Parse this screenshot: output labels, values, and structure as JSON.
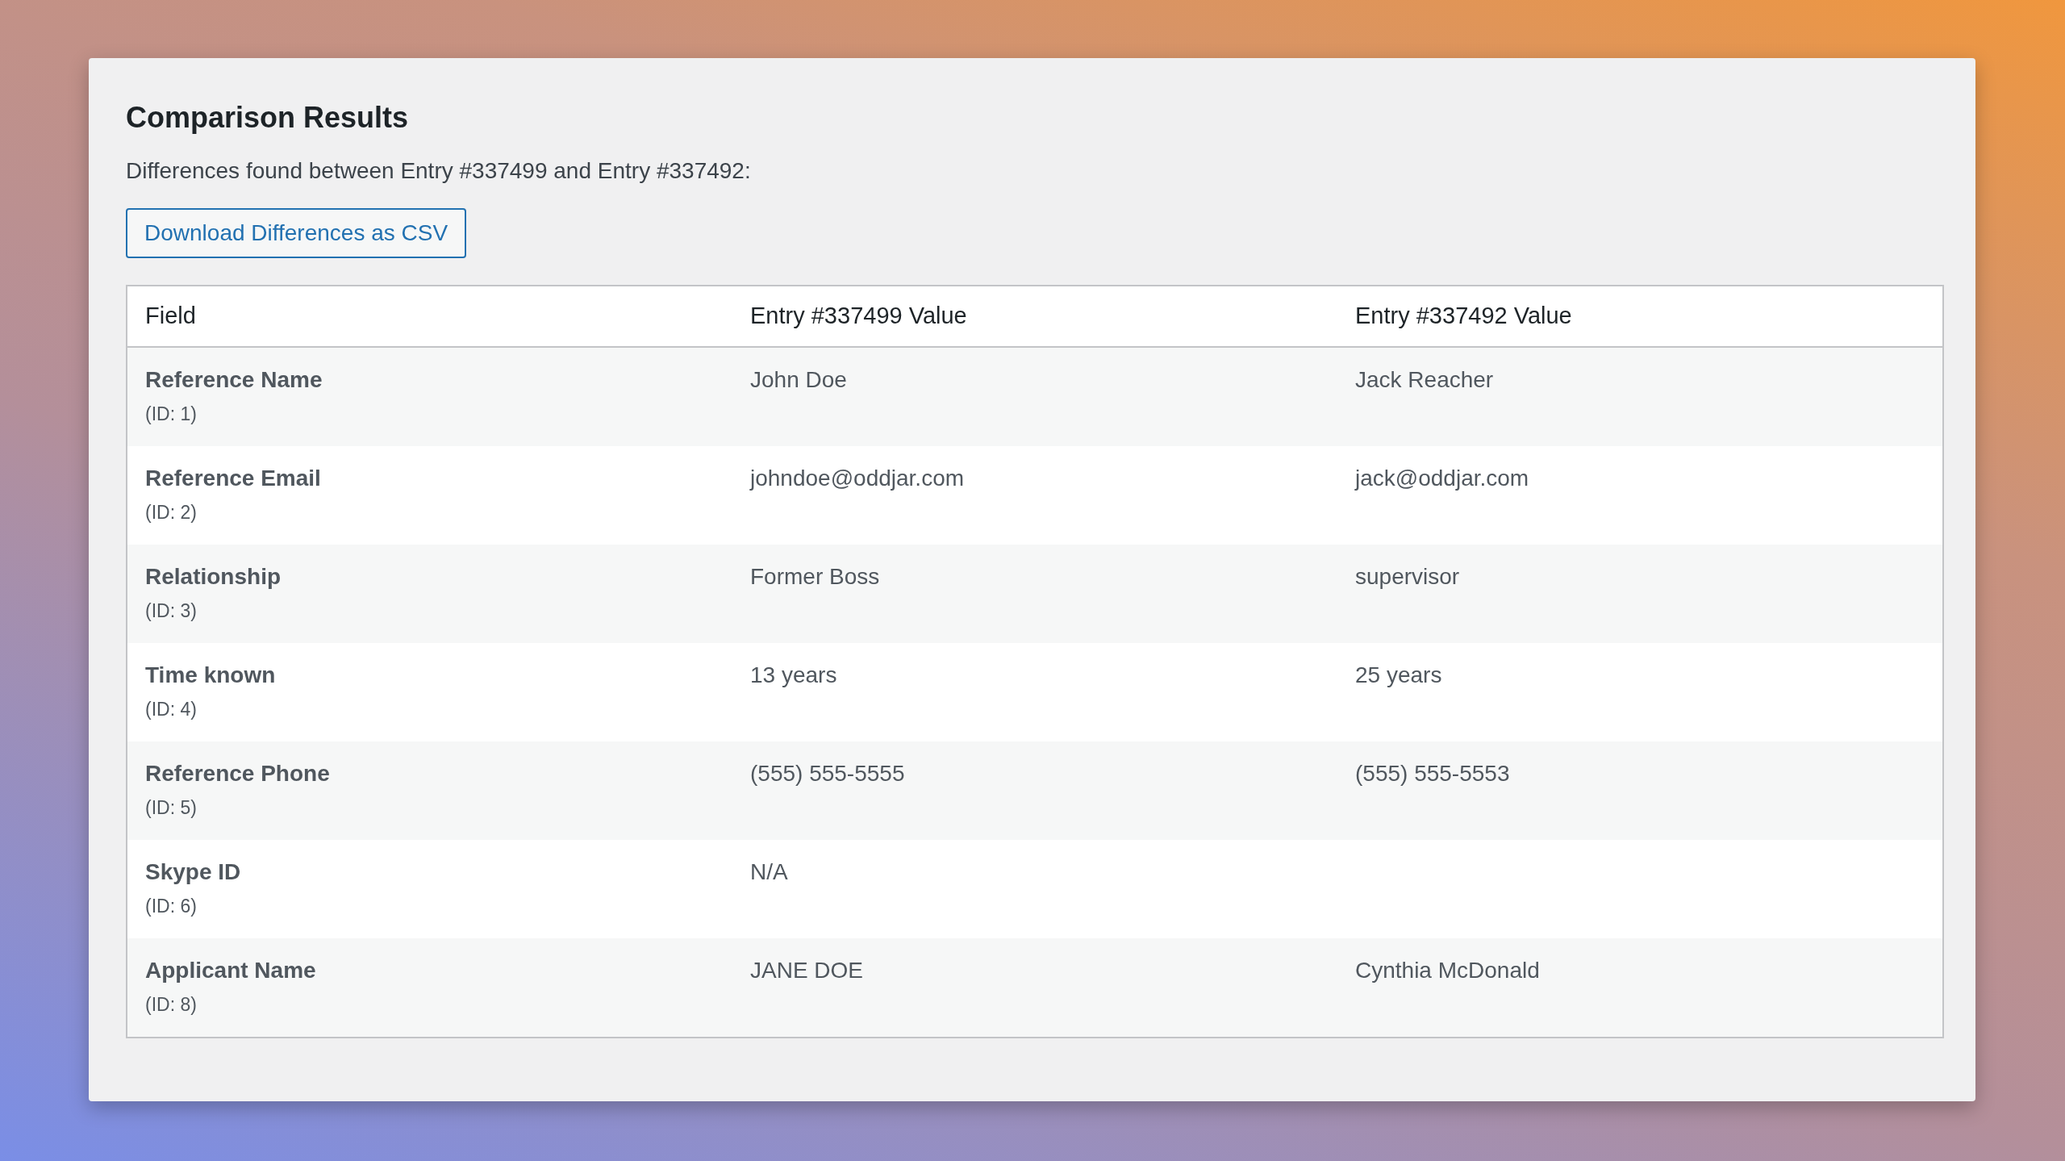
{
  "title": "Comparison Results",
  "summary": "Differences found between Entry #337499 and Entry #337492:",
  "download_button": "Download Differences as CSV",
  "table": {
    "columns": [
      "Field",
      "Entry #337499 Value",
      "Entry #337492 Value"
    ],
    "rows": [
      {
        "field": "Reference Name",
        "id": "(ID: 1)",
        "value_a": "John Doe",
        "value_b": "Jack Reacher"
      },
      {
        "field": "Reference Email",
        "id": "(ID: 2)",
        "value_a": "johndoe@oddjar.com",
        "value_b": "jack@oddjar.com"
      },
      {
        "field": "Relationship",
        "id": "(ID: 3)",
        "value_a": "Former Boss",
        "value_b": "supervisor"
      },
      {
        "field": "Time known",
        "id": "(ID: 4)",
        "value_a": "13 years",
        "value_b": "25 years"
      },
      {
        "field": "Reference Phone",
        "id": "(ID: 5)",
        "value_a": "(555) 555-5555",
        "value_b": "(555) 555-5553"
      },
      {
        "field": "Skype ID",
        "id": "(ID: 6)",
        "value_a": "N/A"
      },
      {
        "field": "Applicant Name",
        "id": "(ID: 8)",
        "value_a": "JANE DOE",
        "value_b": "Cynthia McDonald"
      }
    ]
  }
}
